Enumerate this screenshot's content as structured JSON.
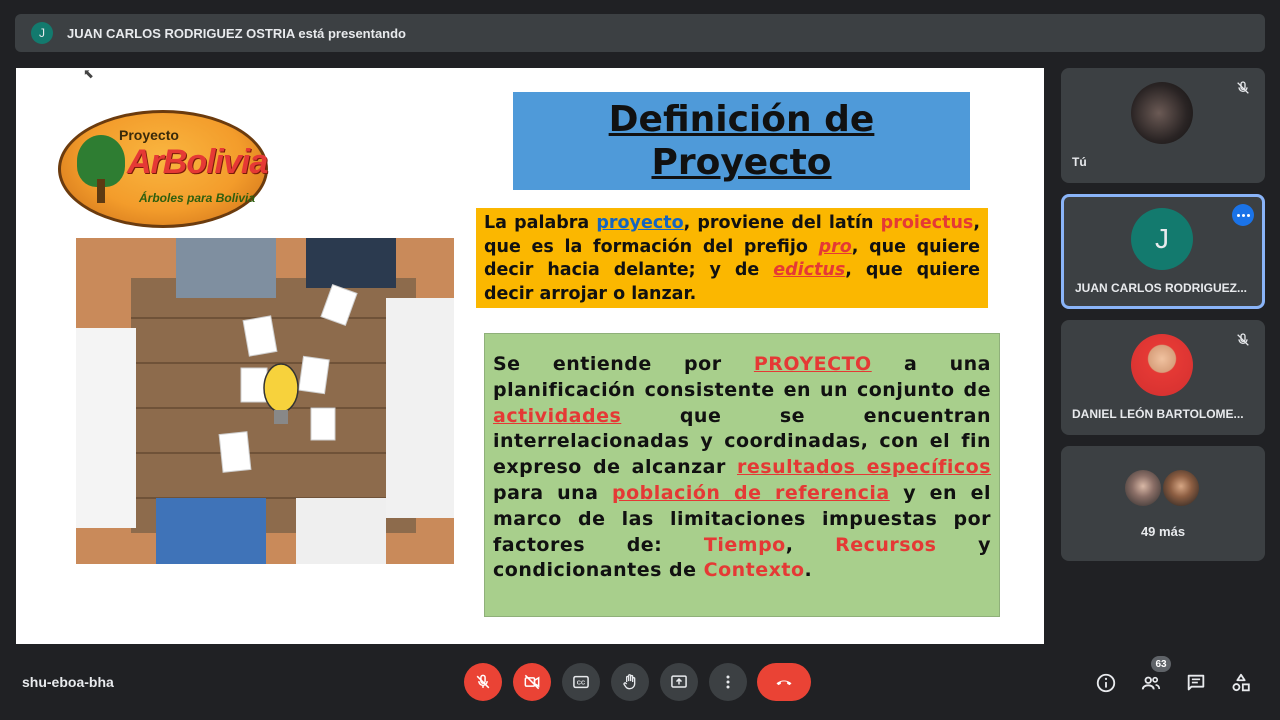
{
  "banner": {
    "avatar_letter": "J",
    "text": "JUAN CARLOS RODRIGUEZ OSTRIA está presentando"
  },
  "slide": {
    "logo": {
      "top": "Proyecto",
      "main": "ArBolivia",
      "sub": "Árboles para Bolivia"
    },
    "title_line1": "Definición de",
    "title_line2": "Proyecto",
    "definition": {
      "p1": "La palabra ",
      "kw1": "proyecto",
      "p2": ", proviene del latín ",
      "kw2": "proiectus",
      "p3": ", que es la formación del prefijo ",
      "kw3": "pro",
      "p4": ", que quiere decir hacia delante; y de ",
      "kw4": "edictus",
      "p5": ", que quiere decir arrojar o lanzar."
    },
    "meaning": {
      "p1": "Se entiende por ",
      "kw1": "PROYECTO",
      "p2": " a una planificación consistente en un conjunto de ",
      "kw2": "actividades",
      "p3": " que se encuentran interrelacionadas y coordinadas, con el fin expreso de alcanzar ",
      "kw3": "resultados específicos",
      "p4": " para una ",
      "kw4": "población de referencia",
      "p5": " y en el marco de las limitaciones impuestas por factores de: ",
      "kw5": "Tiempo",
      "p6": ", ",
      "kw6": "Recursos",
      "p7": " y condicionantes de ",
      "kw7": "Contexto",
      "p8": "."
    }
  },
  "participants": {
    "you": {
      "name": "Tú",
      "muted": true
    },
    "presenter": {
      "name": "JUAN CARLOS RODRIGUEZ...",
      "avatar_letter": "J",
      "avatar_color": "#137a6e"
    },
    "daniel": {
      "name": "DANIEL LEÓN BARTOLOME...",
      "muted": true
    },
    "others": {
      "label": "49 más"
    }
  },
  "bottom_bar": {
    "meeting_code": "shu-eboa-bha",
    "participants_count": "63",
    "controls": [
      "mic-off",
      "camera-off",
      "captions",
      "raise-hand",
      "present",
      "more-options",
      "leave-call"
    ],
    "right_controls": [
      "meeting-details",
      "people",
      "chat",
      "activities"
    ]
  },
  "colors": {
    "background": "#202124",
    "tile": "#3c4043",
    "danger": "#ea4335",
    "accent": "#8ab4f8"
  }
}
